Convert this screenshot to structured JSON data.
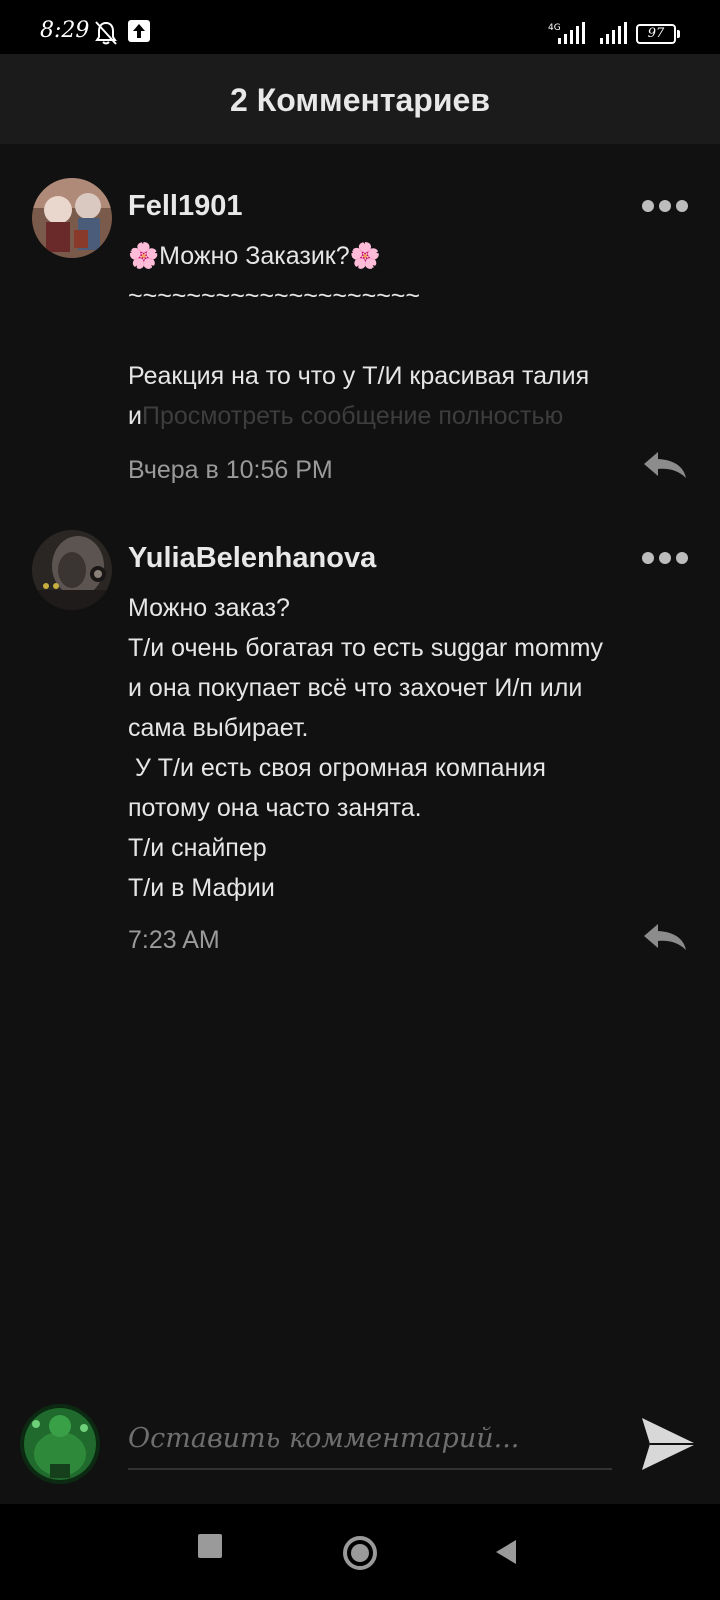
{
  "status_bar": {
    "time": "8:29",
    "network": "4G",
    "battery": "97",
    "icons": [
      "bell-off-icon",
      "upload-icon",
      "signal-icon",
      "battery-icon"
    ]
  },
  "header": {
    "title": "2 Комментариев"
  },
  "comments": [
    {
      "author": "Fell1901",
      "text": "🌸Можно Заказик?🌸\n~~~~~~~~~~~~~~~~~~~~\n\nРеакция на то что у Т/И красивая талия\nи",
      "view_full": "Просмотреть сообщение полностью",
      "time": "Вчера в 10:56 PM"
    },
    {
      "author": "YuliaBelenhanova",
      "text": "Можно заказ?\nТ/и очень богатая то есть suggar mommy\nи она покупает всё что захочет И/п или\nсама выбирает.\n У Т/и есть своя огромная компания\nпотому она часто занята.\nТ/и снайпер\nТ/и в Мафии",
      "time": "7:23 AM"
    }
  ],
  "composer": {
    "placeholder": "Оставить комментарий..."
  },
  "colors": {
    "background": "#111111",
    "header": "#1b1b1b",
    "text": "#e6e6e6",
    "muted": "#9a9a9a",
    "faded": "#3d3d3d"
  }
}
